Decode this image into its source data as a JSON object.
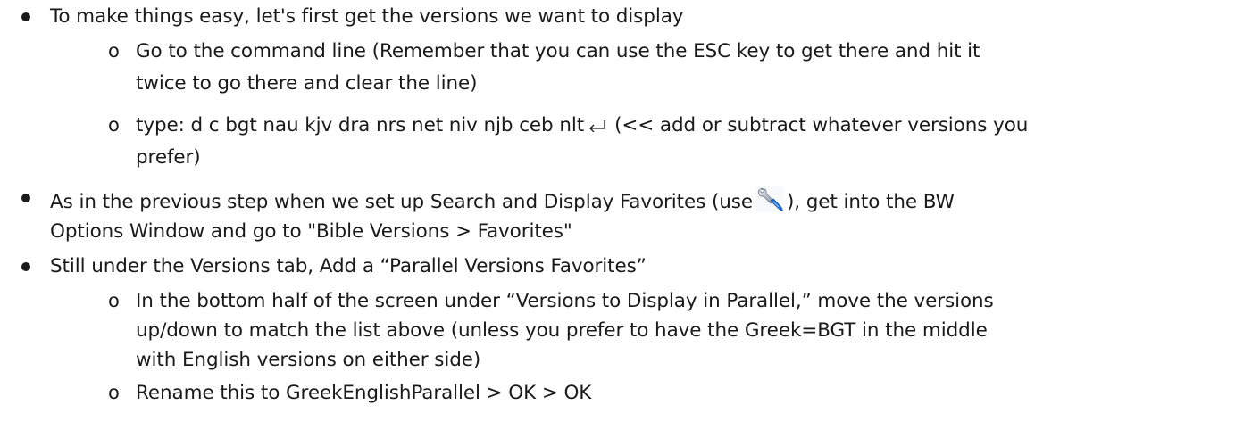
{
  "bullets": {
    "b1": {
      "text": "To make things easy, let's first get the versions we want to display",
      "sub1": {
        "line1": "Go to the command line (Remember that you can use the ESC key to get there and hit it",
        "line2": "twice to go there and clear the line)"
      },
      "sub2": {
        "line1_before": "type: d c bgt nau kjv dra nrs net niv njb ceb nlt",
        "return_icon": "return-key-icon",
        "line1_after": "(<< add or subtract whatever versions you",
        "line2": "prefer)"
      }
    },
    "b2": {
      "line1_before": "As in the previous step when we set up Search and Display Favorites (use",
      "options_icon": "wrench-options-icon",
      "line1_after": "), get into the BW",
      "line2": "Options Window and go to \"Bible Versions > Favorites\""
    },
    "b3": {
      "text": "Still under the Versions tab, Add a “Parallel Versions Favorites”",
      "sub1": {
        "line1": "In the bottom half of the screen under “Versions to Display in Parallel,” move the versions",
        "line2": "up/down to match the list above (unless you prefer to have the Greek=BGT in the middle",
        "line3": "with English versions on either side)"
      },
      "sub2": {
        "line1": "Rename this to GreekEnglishParallel > OK > OK"
      }
    }
  }
}
